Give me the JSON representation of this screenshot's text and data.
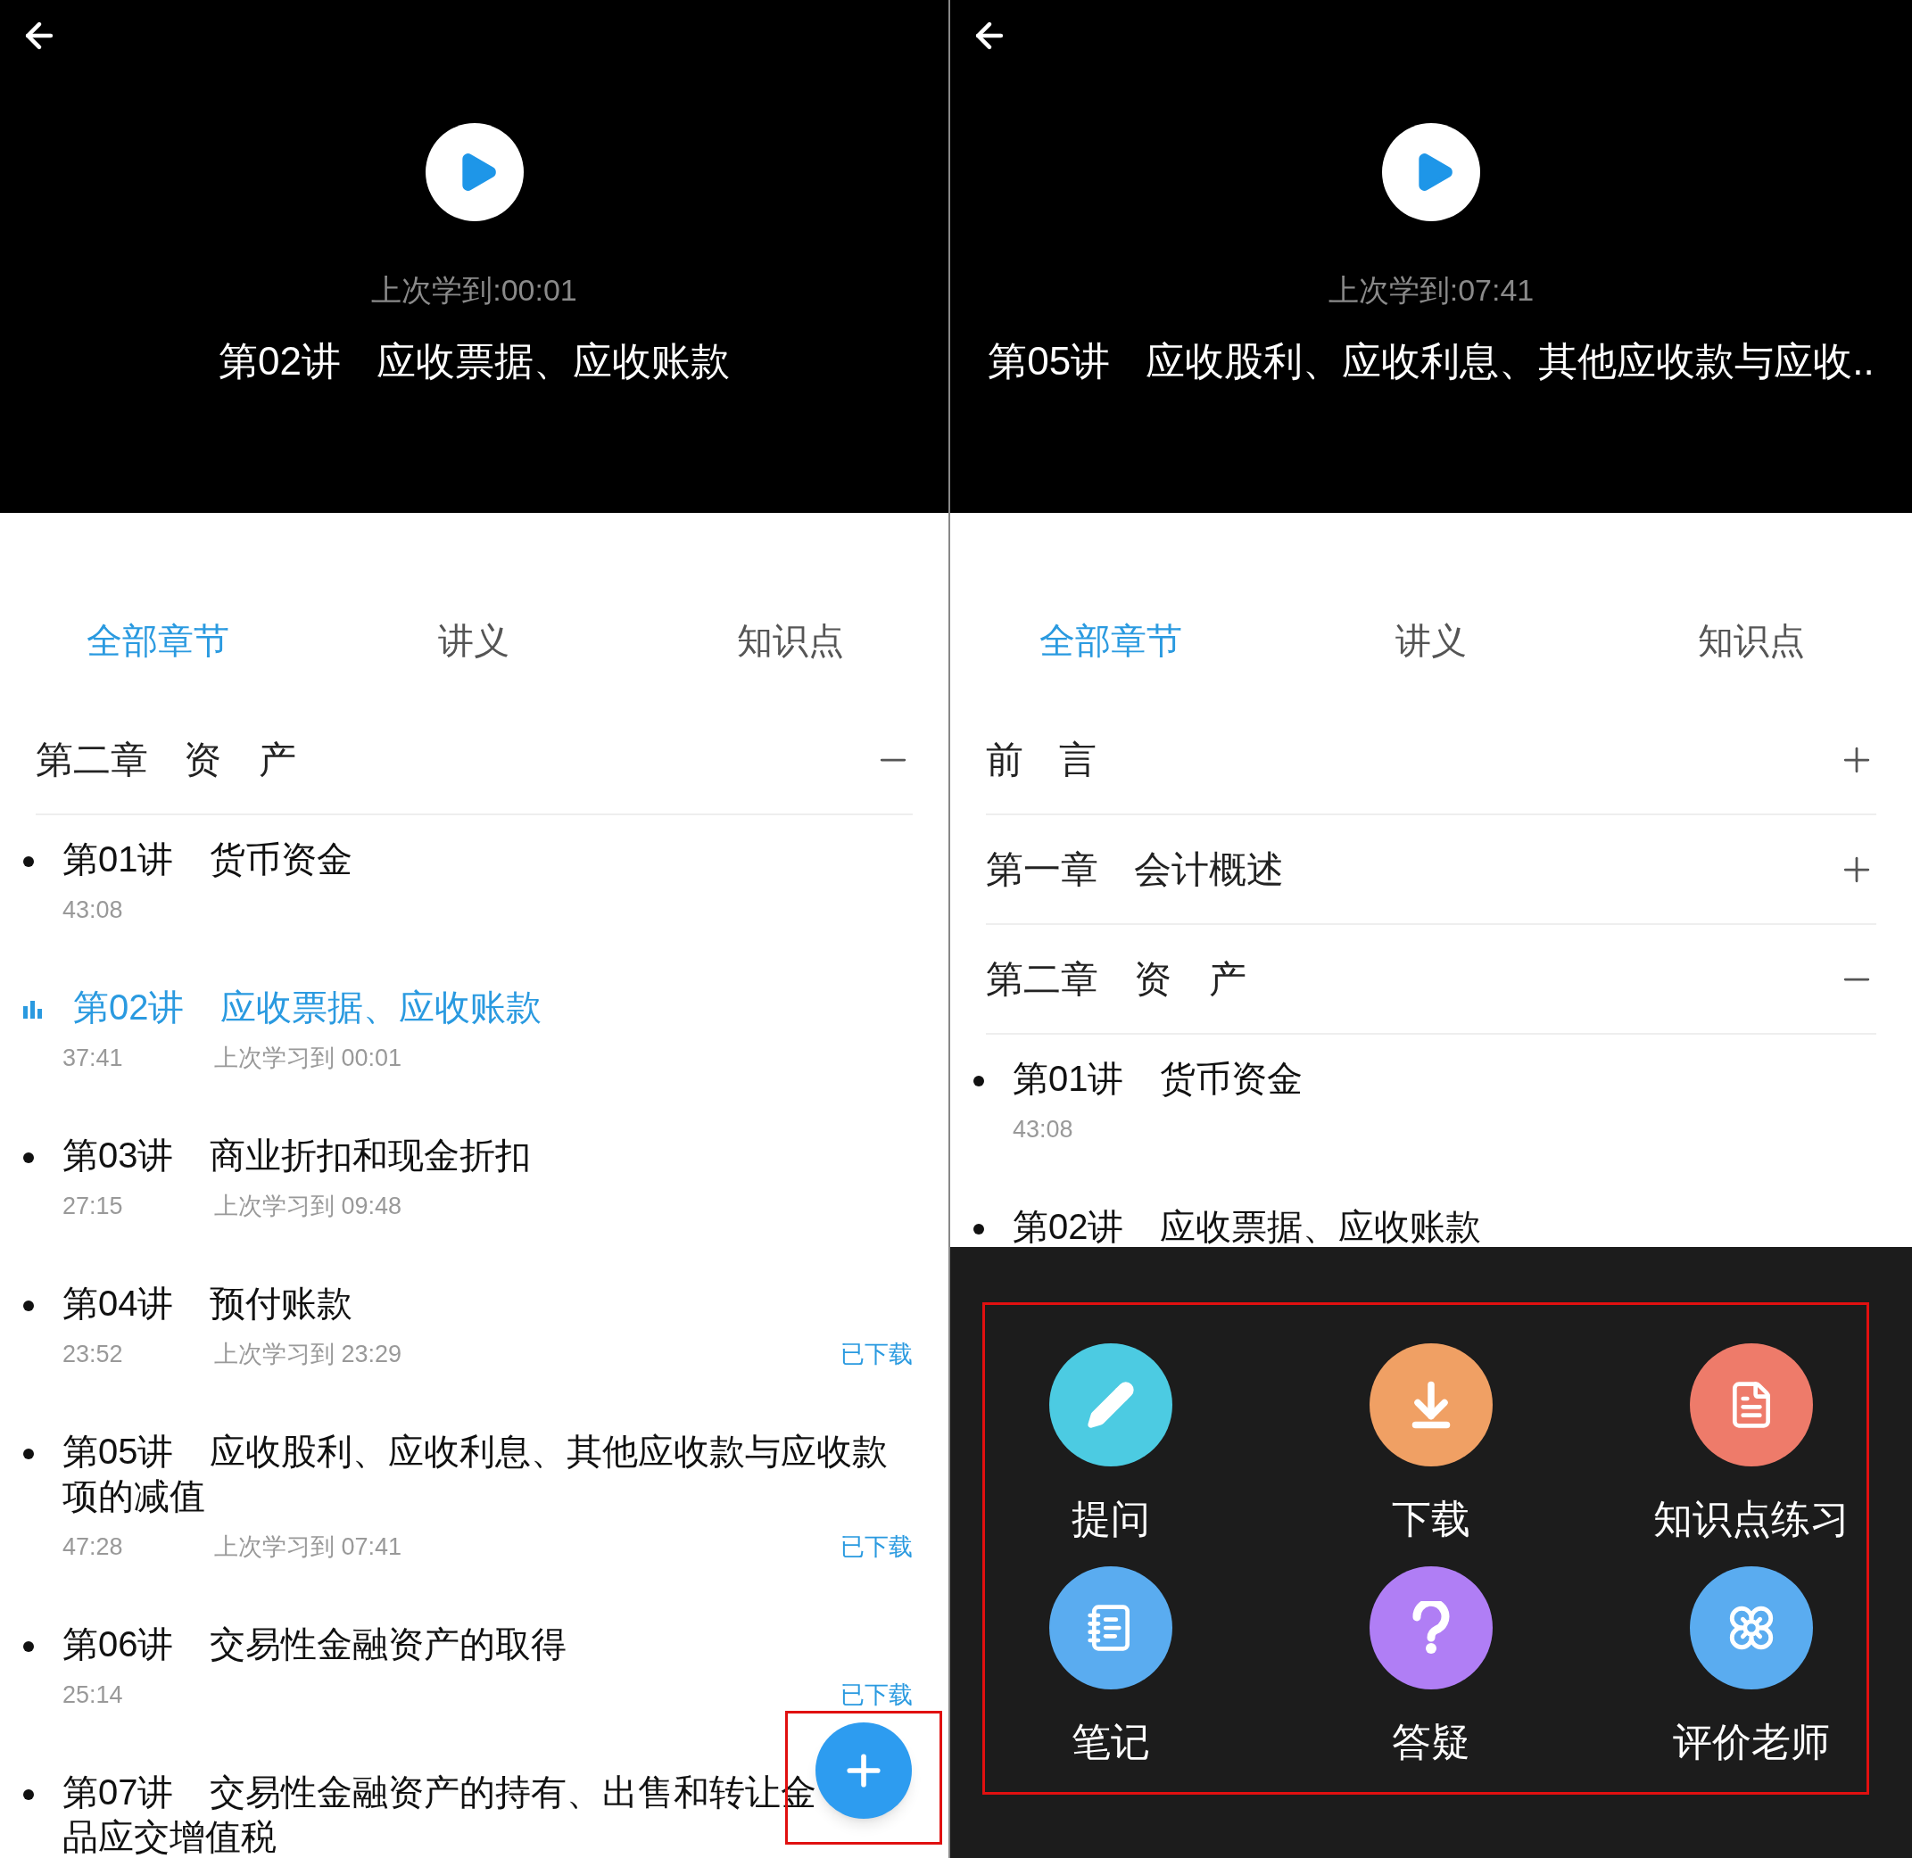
{
  "panels": [
    {
      "header": {
        "last_position": "上次学到:00:01",
        "number": "第02讲",
        "name": "应收票据、应收账款"
      },
      "tabs": [
        {
          "label": "全部章节",
          "selected": true
        },
        {
          "label": "讲义",
          "selected": false
        },
        {
          "label": "知识点",
          "selected": false
        }
      ],
      "chapters": [
        {
          "number": "第二章",
          "name": "资　产",
          "expanded": true,
          "lessons": [
            {
              "number": "第01讲",
              "name": "货币资金",
              "duration": "43:08",
              "selected": false
            },
            {
              "number": "第02讲",
              "name": "应收票据、应收账款",
              "duration": "37:41",
              "progress": "上次学习到 00:01",
              "selected": true
            },
            {
              "number": "第03讲",
              "name": "商业折扣和现金折扣",
              "duration": "27:15",
              "progress": "上次学习到 09:48",
              "selected": false
            },
            {
              "number": "第04讲",
              "name": "预付账款",
              "duration": "23:52",
              "progress": "上次学习到 23:29",
              "badge": "已下载",
              "selected": false
            },
            {
              "number": "第05讲",
              "name": "应收股利、应收利息、其他应收款与应收款项的减值",
              "duration": "47:28",
              "progress": "上次学习到 07:41",
              "badge": "已下载",
              "selected": false
            },
            {
              "number": "第06讲",
              "name": "交易性金融资产的取得",
              "duration": "25:14",
              "badge": "已下载",
              "selected": false
            },
            {
              "number": "第07讲",
              "name": "交易性金融资产的持有、出售和转让金",
              "continuation": "品应交增值税",
              "selected": false
            }
          ]
        }
      ],
      "menu_open": false
    },
    {
      "header": {
        "last_position": "上次学到:07:41",
        "number": "第05讲",
        "name": "应收股利、应收利息、其他应收款与应收.."
      },
      "tabs": [
        {
          "label": "全部章节",
          "selected": true
        },
        {
          "label": "讲义",
          "selected": false
        },
        {
          "label": "知识点",
          "selected": false
        }
      ],
      "chapters": [
        {
          "number": "前",
          "name": "言",
          "expanded": false
        },
        {
          "number": "第一章",
          "name": "会计概述",
          "expanded": false
        },
        {
          "number": "第二章",
          "name": "资　产",
          "expanded": true,
          "lessons": [
            {
              "number": "第01讲",
              "name": "货币资金",
              "duration": "43:08",
              "selected": false
            },
            {
              "number": "第02讲",
              "name": "应收票据、应收账款",
              "selected": false
            }
          ]
        }
      ],
      "menu_open": true,
      "actions": [
        {
          "kind": "ask",
          "label": "提问",
          "color": "#4ccbe2"
        },
        {
          "kind": "download",
          "label": "下载",
          "color": "#f0a064"
        },
        {
          "kind": "practice",
          "label": "知识点练习",
          "color": "#ee7b6a"
        },
        {
          "kind": "notes",
          "label": "笔记",
          "color": "#5aacf0"
        },
        {
          "kind": "qa",
          "label": "答疑",
          "color": "#b07ef5"
        },
        {
          "kind": "rate",
          "label": "评价老师",
          "color": "#5aacf0"
        }
      ]
    }
  ]
}
